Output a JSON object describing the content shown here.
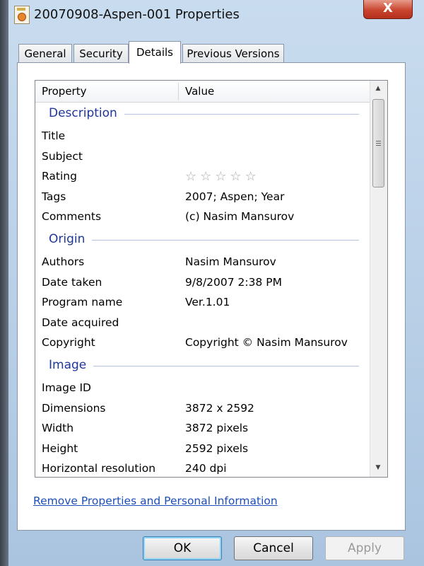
{
  "window": {
    "title": "20070908-Aspen-001 Properties",
    "close_label": "X"
  },
  "tabs": [
    {
      "label": "General"
    },
    {
      "label": "Security"
    },
    {
      "label": "Details"
    },
    {
      "label": "Previous Versions"
    }
  ],
  "list": {
    "header": {
      "property": "Property",
      "value": "Value"
    },
    "sections": [
      {
        "title": "Description",
        "rows": [
          {
            "property": "Title",
            "value": ""
          },
          {
            "property": "Subject",
            "value": ""
          },
          {
            "property": "Rating",
            "value": "",
            "stars": 0,
            "max_stars": 5
          },
          {
            "property": "Tags",
            "value": "2007; Aspen; Year"
          },
          {
            "property": "Comments",
            "value": "(c) Nasim Mansurov"
          }
        ]
      },
      {
        "title": "Origin",
        "rows": [
          {
            "property": "Authors",
            "value": "Nasim Mansurov"
          },
          {
            "property": "Date taken",
            "value": "9/8/2007 2:38 PM"
          },
          {
            "property": "Program name",
            "value": "Ver.1.01"
          },
          {
            "property": "Date acquired",
            "value": ""
          },
          {
            "property": "Copyright",
            "value": "Copyright © Nasim Mansurov"
          }
        ]
      },
      {
        "title": "Image",
        "rows": [
          {
            "property": "Image ID",
            "value": ""
          },
          {
            "property": "Dimensions",
            "value": "3872 x 2592"
          },
          {
            "property": "Width",
            "value": "3872 pixels"
          },
          {
            "property": "Height",
            "value": "2592 pixels"
          },
          {
            "property": "Horizontal resolution",
            "value": "240 dpi"
          }
        ]
      }
    ]
  },
  "link": {
    "label": "Remove Properties and Personal Information"
  },
  "buttons": {
    "ok": "OK",
    "cancel": "Cancel",
    "apply": "Apply"
  },
  "colors": {
    "section_title": "#1e3799",
    "link": "#1c4fb8"
  }
}
